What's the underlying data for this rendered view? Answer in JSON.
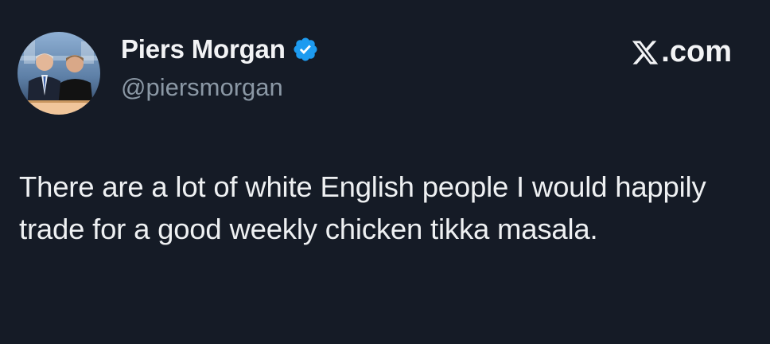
{
  "author": {
    "display_name": "Piers Morgan",
    "handle": "@piersmorgan",
    "verified": true,
    "verified_color": "#1d9bf0"
  },
  "brand": {
    "label": ".com",
    "icon": "x-logo-icon"
  },
  "tweet": {
    "text": "There are a lot of white English people I would happily trade for a good weekly chicken tikka masala."
  },
  "colors": {
    "background": "#151b26",
    "text": "#eef0f2",
    "secondary_text": "#8b98a5"
  }
}
